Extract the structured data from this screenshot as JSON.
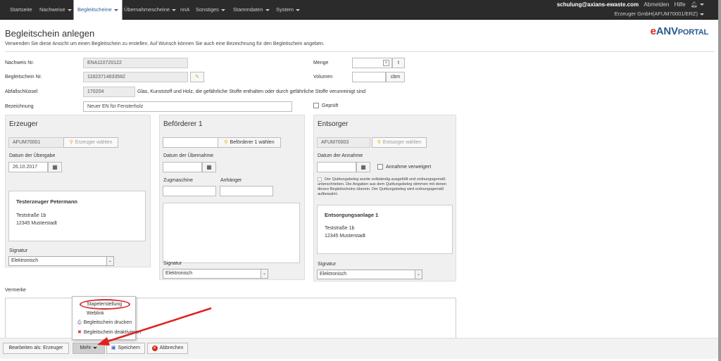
{
  "nav": {
    "items": [
      {
        "label": "Startseite"
      },
      {
        "label": "Nachweise"
      },
      {
        "label": "Begleitscheine"
      },
      {
        "label": "Übernahmescheine"
      },
      {
        "label": "nnA"
      },
      {
        "label": "Sonstiges"
      },
      {
        "label": "Stammdaten"
      },
      {
        "label": "System"
      }
    ],
    "user_email": "schulung@axians-ewaste.com",
    "logout": "Abmelden",
    "help": "Hilfe",
    "company": "Erzeuger GmbH(AFUM70001/ERZ)"
  },
  "page": {
    "title": "Begleitschein anlegen",
    "description": "Verwenden Sie diese Ansicht um einen Begleitschein zu erstellen. Auf Wunsch können Sie auch eine Bezeichnung für den Begleitschein angeben.",
    "logo_e": "e",
    "logo_anv": "ANV",
    "logo_portal": "PORTAL"
  },
  "form": {
    "nachweis_label": "Nachweis Nr.",
    "nachweis_value": "ENA110720122",
    "begleitschein_label": "Begleitschein Nr.",
    "begleitschein_value": "11823714833582",
    "abfall_label": "Abfallschlüssel",
    "abfall_value": "170204",
    "abfall_text": "Glas, Kunststoff und Holz, die gefährliche Stoffe enthalten oder durch gefährliche Stoffe verunreinigt sind",
    "bezeichnung_label": "Bezeichnung",
    "bezeichnung_value": "Neuer EN für Fensterholz",
    "menge_label": "Menge",
    "menge_unit": "t",
    "volumen_label": "Volumen",
    "volumen_unit": "cbm",
    "geprueft_label": "Geprüft",
    "vermerke_label": "Vermerke"
  },
  "erzeuger": {
    "title": "Erzeuger",
    "id": "AFUM70001",
    "choose": "Erzeuger wählen",
    "date_label": "Datum der Übergabe",
    "date_value": "26.10.2017",
    "name": "Testerzeuger Petermann",
    "street": "Teststraße 1b",
    "city": "12345 Musterstadt",
    "signatur_label": "Signatur",
    "signatur_value": "Elektronisch"
  },
  "befoerderer": {
    "title": "Beförderer 1",
    "choose": "Beförderer 1 wählen",
    "date_label": "Datum der Übernahme",
    "zug_label": "Zugmaschine",
    "anh_label": "Anhänger",
    "signatur_label": "Signatur",
    "signatur_value": "Elektronisch"
  },
  "entsorger": {
    "title": "Entsorger",
    "id": "AFUM70003",
    "choose": "Entsorger wählen",
    "date_label": "Datum der Annahme",
    "verweigert_label": "Annahme verweigert",
    "quittung_text": "Der Quittungsbeleg wurde vollständig ausgefüllt und ordnungsgemäß unterschrieben. Die Angaben aus dem Quittungsbeleg stimmen mit denen dieses Begleitscheins überein. Der Quittungsbeleg wird ordnungsgemäß aufbewahrt.",
    "name": "Entsorgungsanlage 1",
    "street": "Teststraße 1b",
    "city": "12345 Musterstadt",
    "signatur_label": "Signatur",
    "signatur_value": "Elektronisch"
  },
  "menu": {
    "items": [
      {
        "label": "Stapelerstellung"
      },
      {
        "label": "Weblink"
      },
      {
        "label": "Begleitschein drucken"
      },
      {
        "label": "Begleitschein deaktivieren"
      }
    ]
  },
  "bottom": {
    "bearbeiten": "Bearbeiten als: Erzeuger",
    "mehr": "Mehr",
    "speichern": "Speichern",
    "abbrechen": "Abbrechen"
  },
  "colors": {
    "accent_red": "#e0251b",
    "logo_blue": "#2a5a8e",
    "nav_bg": "#2b2b2b"
  }
}
